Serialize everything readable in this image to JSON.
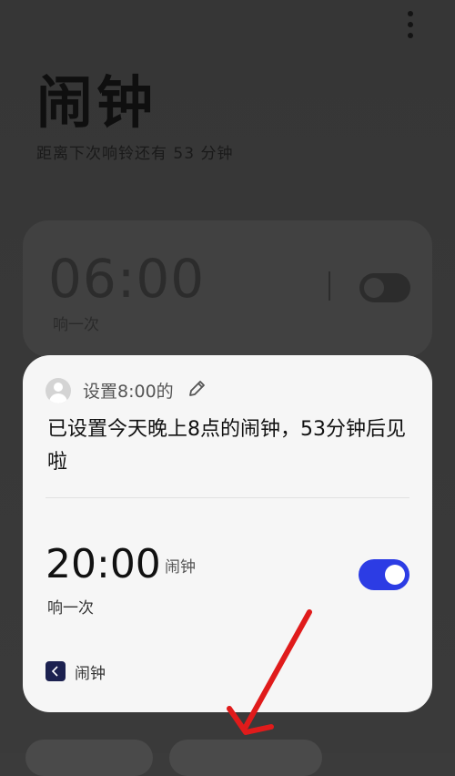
{
  "header": {
    "title": "闹钟",
    "next_alarm_text": "距离下次响铃还有 53 分钟",
    "menu_icon": "more-vertical-icon"
  },
  "background_alarm": {
    "time": "06:00",
    "repeat": "响一次",
    "enabled": false
  },
  "assistant_card": {
    "command": "设置8:00的",
    "reply": "已设置今天晚上8点的闹钟，53分钟后见啦",
    "alarm_time": "20:00",
    "alarm_label": "闹钟",
    "repeat": "响一次",
    "enabled": true,
    "app_name": "闹钟"
  },
  "colors": {
    "toggle_on": "#2c3ce4",
    "arrow": "#e01b1b",
    "card_bg": "#f6f6f6",
    "overlay_bg": "#3b3b3b"
  }
}
